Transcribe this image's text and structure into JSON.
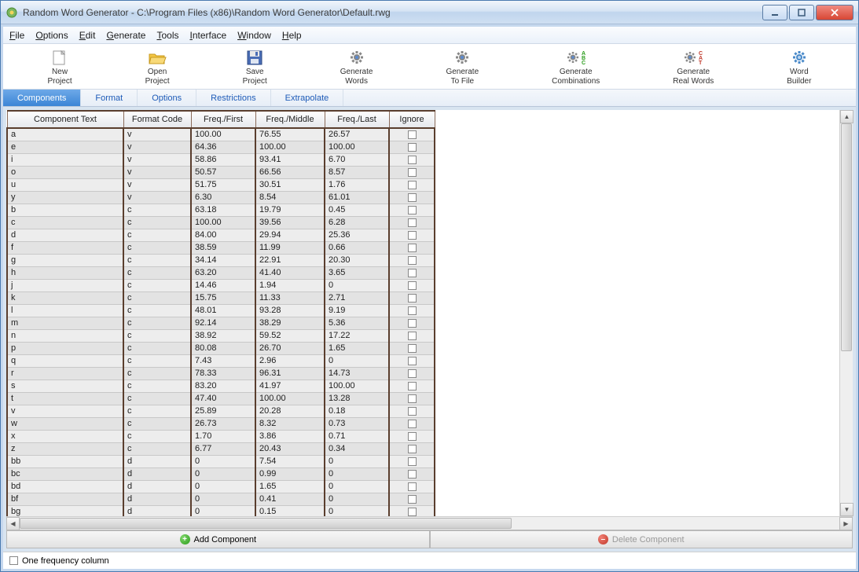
{
  "window": {
    "title": "Random Word Generator - C:\\Program Files (x86)\\Random Word Generator\\Default.rwg"
  },
  "menubar": [
    "File",
    "Options",
    "Edit",
    "Generate",
    "Tools",
    "Interface",
    "Window",
    "Help"
  ],
  "toolbar": [
    {
      "label1": "New",
      "label2": "Project",
      "icon": "new-project"
    },
    {
      "label1": "Open",
      "label2": "Project",
      "icon": "open-project"
    },
    {
      "label1": "Save",
      "label2": "Project",
      "icon": "save-project"
    },
    {
      "label1": "Generate",
      "label2": "Words",
      "icon": "generate-words"
    },
    {
      "label1": "Generate",
      "label2": "To File",
      "icon": "generate-to-file"
    },
    {
      "label1": "Generate",
      "label2": "Combinations",
      "icon": "generate-combinations"
    },
    {
      "label1": "Generate",
      "label2": "Real Words",
      "icon": "generate-real-words"
    },
    {
      "label1": "Word",
      "label2": "Builder",
      "icon": "word-builder"
    }
  ],
  "tabs": [
    "Components",
    "Format",
    "Options",
    "Restrictions",
    "Extrapolate"
  ],
  "active_tab": 0,
  "columns": [
    "Component Text",
    "Format Code",
    "Freq./First",
    "Freq./Middle",
    "Freq./Last",
    "Ignore"
  ],
  "rows": [
    {
      "text": "a",
      "code": "v",
      "first": "100.00",
      "middle": "76.55",
      "last": "26.57"
    },
    {
      "text": "e",
      "code": "v",
      "first": "64.36",
      "middle": "100.00",
      "last": "100.00"
    },
    {
      "text": "i",
      "code": "v",
      "first": "58.86",
      "middle": "93.41",
      "last": "6.70"
    },
    {
      "text": "o",
      "code": "v",
      "first": "50.57",
      "middle": "66.56",
      "last": "8.57"
    },
    {
      "text": "u",
      "code": "v",
      "first": "51.75",
      "middle": "30.51",
      "last": "1.76"
    },
    {
      "text": "y",
      "code": "v",
      "first": "6.30",
      "middle": "8.54",
      "last": "61.01"
    },
    {
      "text": "b",
      "code": "c",
      "first": "63.18",
      "middle": "19.79",
      "last": "0.45"
    },
    {
      "text": "c",
      "code": "c",
      "first": "100.00",
      "middle": "39.56",
      "last": "6.28"
    },
    {
      "text": "d",
      "code": "c",
      "first": "84.00",
      "middle": "29.94",
      "last": "25.36"
    },
    {
      "text": "f",
      "code": "c",
      "first": "38.59",
      "middle": "11.99",
      "last": "0.66"
    },
    {
      "text": "g",
      "code": "c",
      "first": "34.14",
      "middle": "22.91",
      "last": "20.30"
    },
    {
      "text": "h",
      "code": "c",
      "first": "63.20",
      "middle": "41.40",
      "last": "3.65"
    },
    {
      "text": "j",
      "code": "c",
      "first": "14.46",
      "middle": "1.94",
      "last": "0"
    },
    {
      "text": "k",
      "code": "c",
      "first": "15.75",
      "middle": "11.33",
      "last": "2.71"
    },
    {
      "text": "l",
      "code": "c",
      "first": "48.01",
      "middle": "93.28",
      "last": "9.19"
    },
    {
      "text": "m",
      "code": "c",
      "first": "92.14",
      "middle": "38.29",
      "last": "5.36"
    },
    {
      "text": "n",
      "code": "c",
      "first": "38.92",
      "middle": "59.52",
      "last": "17.22"
    },
    {
      "text": "p",
      "code": "c",
      "first": "80.08",
      "middle": "26.70",
      "last": "1.65"
    },
    {
      "text": "q",
      "code": "c",
      "first": "7.43",
      "middle": "2.96",
      "last": "0"
    },
    {
      "text": "r",
      "code": "c",
      "first": "78.33",
      "middle": "96.31",
      "last": "14.73"
    },
    {
      "text": "s",
      "code": "c",
      "first": "83.20",
      "middle": "41.97",
      "last": "100.00"
    },
    {
      "text": "t",
      "code": "c",
      "first": "47.40",
      "middle": "100.00",
      "last": "13.28"
    },
    {
      "text": "v",
      "code": "c",
      "first": "25.89",
      "middle": "20.28",
      "last": "0.18"
    },
    {
      "text": "w",
      "code": "c",
      "first": "26.73",
      "middle": "8.32",
      "last": "0.73"
    },
    {
      "text": "x",
      "code": "c",
      "first": "1.70",
      "middle": "3.86",
      "last": "0.71"
    },
    {
      "text": "z",
      "code": "c",
      "first": "6.77",
      "middle": "20.43",
      "last": "0.34"
    },
    {
      "text": "bb",
      "code": "d",
      "first": "0",
      "middle": "7.54",
      "last": "0"
    },
    {
      "text": "bc",
      "code": "d",
      "first": "0",
      "middle": "0.99",
      "last": "0"
    },
    {
      "text": "bd",
      "code": "d",
      "first": "0",
      "middle": "1.65",
      "last": "0"
    },
    {
      "text": "bf",
      "code": "d",
      "first": "0",
      "middle": "0.41",
      "last": "0"
    },
    {
      "text": "bg",
      "code": "d",
      "first": "0",
      "middle": "0.15",
      "last": "0"
    }
  ],
  "actions": {
    "add": "Add Component",
    "delete": "Delete Component"
  },
  "footer": {
    "one_freq": "One frequency column"
  }
}
